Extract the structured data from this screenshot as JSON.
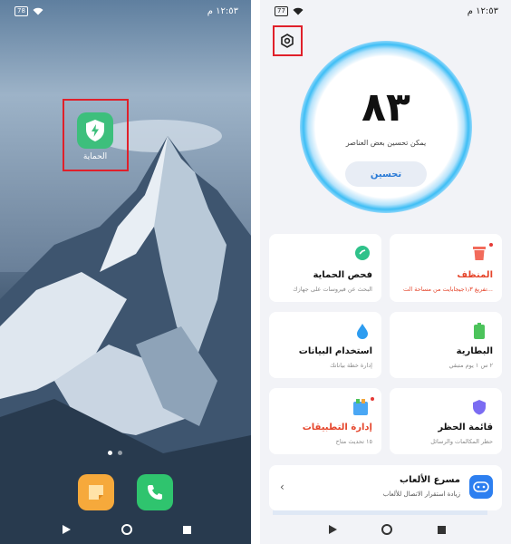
{
  "left_phone": {
    "status": {
      "battery": "78",
      "time": "١٢:٥٣ م"
    },
    "app": {
      "label": "الحماية"
    },
    "highlight_color": "#e0202a"
  },
  "right_phone": {
    "status": {
      "battery": "77",
      "time": "١٢:٥٣ م"
    },
    "score": {
      "value": "٨٣",
      "subtitle": "يمكن تحسين بعض العناصر",
      "button": "تحسين"
    },
    "cards": [
      {
        "title": "فحص الحماية",
        "subtitle": "البحث عن فيروسات على جهازك",
        "icon": "shield-check-icon",
        "color": "#2fc28a"
      },
      {
        "title": "المنظف",
        "subtitle": "تفريغ ١٫٣جيجابايت من مساحة الت...",
        "icon": "trash-icon",
        "color": "#f26b5b"
      },
      {
        "title": "استخدام البيانات",
        "subtitle": "إدارة خطة بياناتك",
        "icon": "droplet-icon",
        "color": "#2d9cf0"
      },
      {
        "title": "البطارية",
        "subtitle": "٢ س ١ يوم متبقي",
        "icon": "battery-icon",
        "color": "#4cc35b"
      },
      {
        "title": "إدارة التطبيقات",
        "subtitle": "١٥ تحديث متاح",
        "icon": "app-manager-icon",
        "color": "#4aa7f4"
      },
      {
        "title": "قائمة الحظر",
        "subtitle": "حظر المكالمات والرسائل",
        "icon": "block-shield-icon",
        "color": "#7b6cf2"
      }
    ],
    "game_turbo": {
      "title": "مسرع الألعاب",
      "subtitle": "زيادة استقرار الاتصال للألعاب"
    },
    "accent_color": "#2b7bd6",
    "highlight_color": "#e0202a"
  }
}
